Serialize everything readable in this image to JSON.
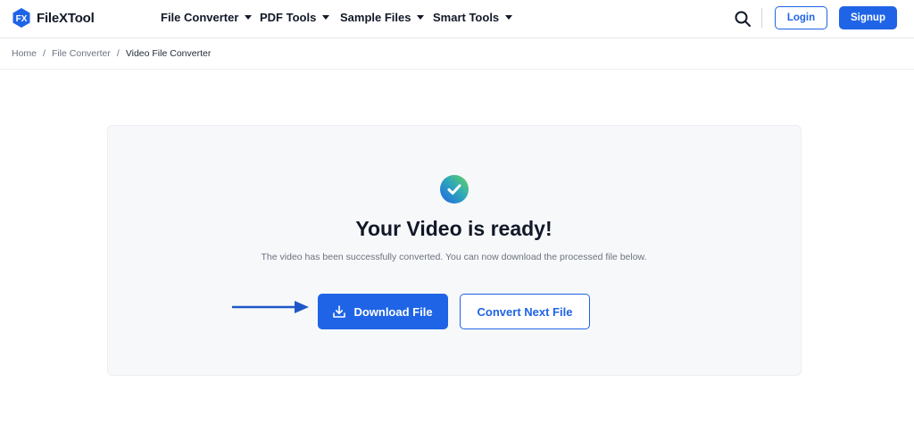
{
  "brand": {
    "mark_text": "FX",
    "name": "FileXTool",
    "accent_color": "#1f64e6"
  },
  "nav": {
    "items": [
      {
        "label": "File Converter",
        "icon": "chevron-down-icon"
      },
      {
        "label": "PDF Tools",
        "icon": "chevron-down-icon"
      },
      {
        "label": "Sample Files",
        "icon": "chevron-down-icon"
      },
      {
        "label": "Smart Tools",
        "icon": "chevron-down-icon"
      }
    ]
  },
  "header_actions": {
    "search_icon": "search-icon",
    "login_label": "Login",
    "signup_label": "Signup"
  },
  "breadcrumb": {
    "items": [
      "Home",
      "File Converter"
    ],
    "current": "Video File Converter",
    "separator": "/"
  },
  "result": {
    "status_icon": "check-circle-icon",
    "title": "Your Video is ready!",
    "subtitle": "The video has been successfully converted. You can now download the processed file below.",
    "download_label": "Download File",
    "download_icon": "download-icon",
    "convert_next_label": "Convert Next File",
    "pointer_icon": "arrow-right-icon"
  }
}
